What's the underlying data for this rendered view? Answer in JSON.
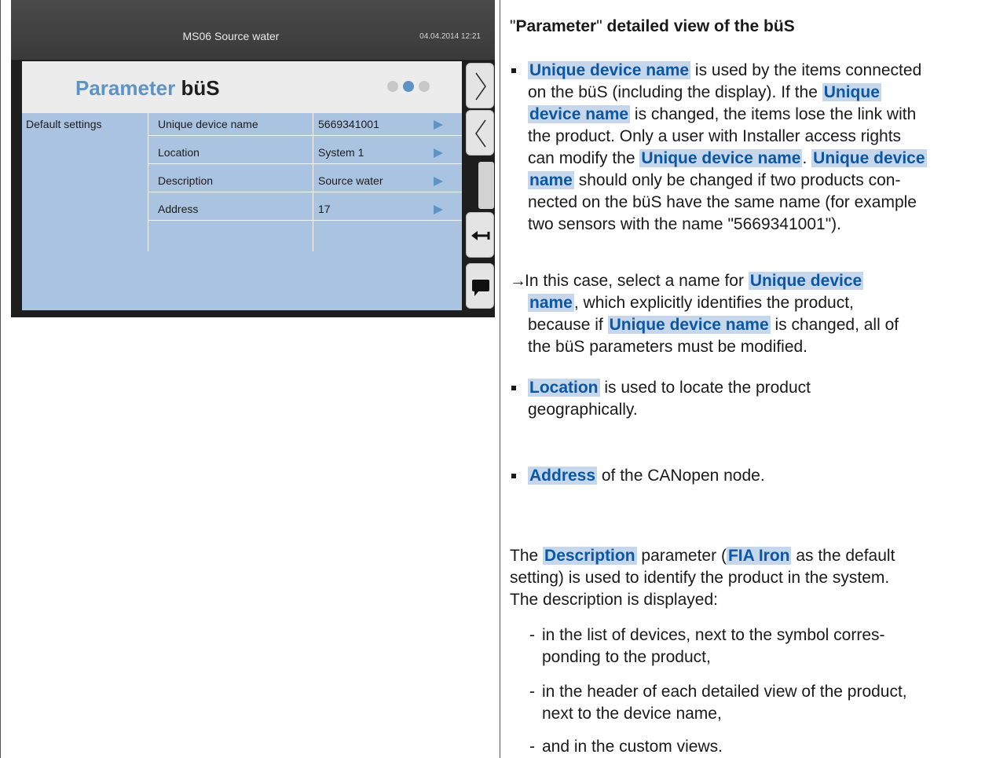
{
  "device": {
    "title": "MS06 Source water",
    "datetime": "04.04.2014 12:21",
    "banner": {
      "title_part1": "Parameter",
      "title_part2": "büS"
    },
    "page_indicator": {
      "count": 3,
      "active_index": 1
    },
    "section_label": "Default settings",
    "rows": [
      {
        "label": "Unique device name",
        "value": "5669341001"
      },
      {
        "label": "Location",
        "value": "System 1"
      },
      {
        "label": "Description",
        "value": "Source water"
      },
      {
        "label": "Address",
        "value": "17"
      }
    ],
    "side_buttons": [
      "chevron-right-icon",
      "chevron-left-icon",
      "back-arrow-icon",
      "speech-bubble-icon"
    ]
  },
  "doc": {
    "heading_q1": "\"",
    "heading_word": "Parameter",
    "heading_q2": "\"",
    "heading_rest": " detailed view of the büS",
    "b1": {
      "k1": "Unique device name",
      "t1": " is used by the items connected",
      "t2": "on the büS (including the display). If the ",
      "k2": "Unique",
      "k3": "device name",
      "t3": " is changed, the items lose the link with",
      "t4": "the product. Only a user with Installer access rights",
      "t5": "can modify the ",
      "k4": "Unique device name",
      "t6": ". ",
      "k5": "Unique device",
      "k6": "name",
      "t7": " should only be changed if two products con-",
      "t8": "nected on the büS have the same name (for example",
      "t9": "two sensors with the name \"5669341001\")."
    },
    "arrow": {
      "symbol": "→",
      "t1": " In this case, select a name for ",
      "k1": "Unique device",
      "k2": "name",
      "t2": ", which explicitly identifies the product,",
      "t3": "because if ",
      "k3": "Unique device name",
      "t4": " is changed, all of",
      "t5": "the büS parameters must be modified."
    },
    "b2": {
      "k1": "Location",
      "t1": " is used to locate the product",
      "t2": "geographically."
    },
    "b3": {
      "k1": "Address",
      "t1": " of the CANopen node."
    },
    "desc": {
      "t1": "The ",
      "k1": "Description",
      "t2": " parameter (",
      "k2": "FIA Iron",
      "t3": " as the default",
      "t4": "setting) is used to identify the product in the system.",
      "t5": "The description is displayed:"
    },
    "dashes": [
      {
        "l1": "in the list of devices, next to the symbol corres-",
        "l2": "ponding to the product,"
      },
      {
        "l1": "in the header of each detailed view of the product,",
        "l2": "next to the device name,"
      },
      {
        "l1": "and in the custom views.",
        "l2": ""
      }
    ]
  }
}
